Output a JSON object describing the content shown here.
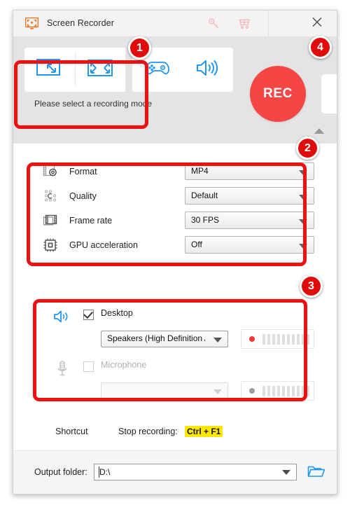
{
  "window": {
    "title": "Screen Recorder",
    "app_icon": "monitor-icon",
    "key_icon": "key-icon",
    "cart_icon": "cart-icon",
    "minimize_label": "–",
    "close_label": "✕"
  },
  "toolbar": {
    "modes": [
      {
        "name": "region-record-mode",
        "icon": "region-select-icon"
      },
      {
        "name": "fullscreen-record-mode",
        "icon": "fullscreen-icon"
      }
    ],
    "tools": [
      {
        "name": "game-record-mode",
        "icon": "gamepad-icon"
      },
      {
        "name": "audio-record-mode",
        "icon": "speaker-icon"
      }
    ],
    "rec_label": "REC",
    "hint": "Please select a recording mode",
    "collapse_icon": "chevron-up-icon"
  },
  "settings": {
    "rows": [
      {
        "icon": "film-gear-icon",
        "label": "Format",
        "value": "MP4",
        "disabled": false
      },
      {
        "icon": "quality-dots-icon",
        "label": "Quality",
        "value": "Default",
        "disabled": false
      },
      {
        "icon": "film-strip-icon",
        "label": "Frame rate",
        "value": "30 FPS",
        "disabled": false
      },
      {
        "icon": "cpu-chip-icon",
        "label": "GPU acceleration",
        "value": "Off",
        "disabled": false
      }
    ]
  },
  "audio": {
    "desktop": {
      "icon": "speaker-icon",
      "label": "Desktop",
      "checked": true,
      "device": "Speakers (High Definition A...",
      "meter_dot_color": "#ef3a3a",
      "meter_bars": 10
    },
    "microphone": {
      "icon": "microphone-icon",
      "label": "Microphone",
      "checked": false,
      "device": "",
      "meter_dot_color": "#9e9e9e",
      "meter_bars": 10
    }
  },
  "shortcut": {
    "label": "Shortcut",
    "stop_label": "Stop recording:",
    "keys": "Ctrl + F1",
    "keys_highlight": "#ffe800"
  },
  "footer": {
    "output_label": "Output folder:",
    "output_value": "D:\\",
    "folder_icon": "folder-icon"
  },
  "annotations": {
    "badges": [
      {
        "number": "1"
      },
      {
        "number": "2"
      },
      {
        "number": "3"
      },
      {
        "number": "4"
      }
    ],
    "color": "#ee1111"
  }
}
